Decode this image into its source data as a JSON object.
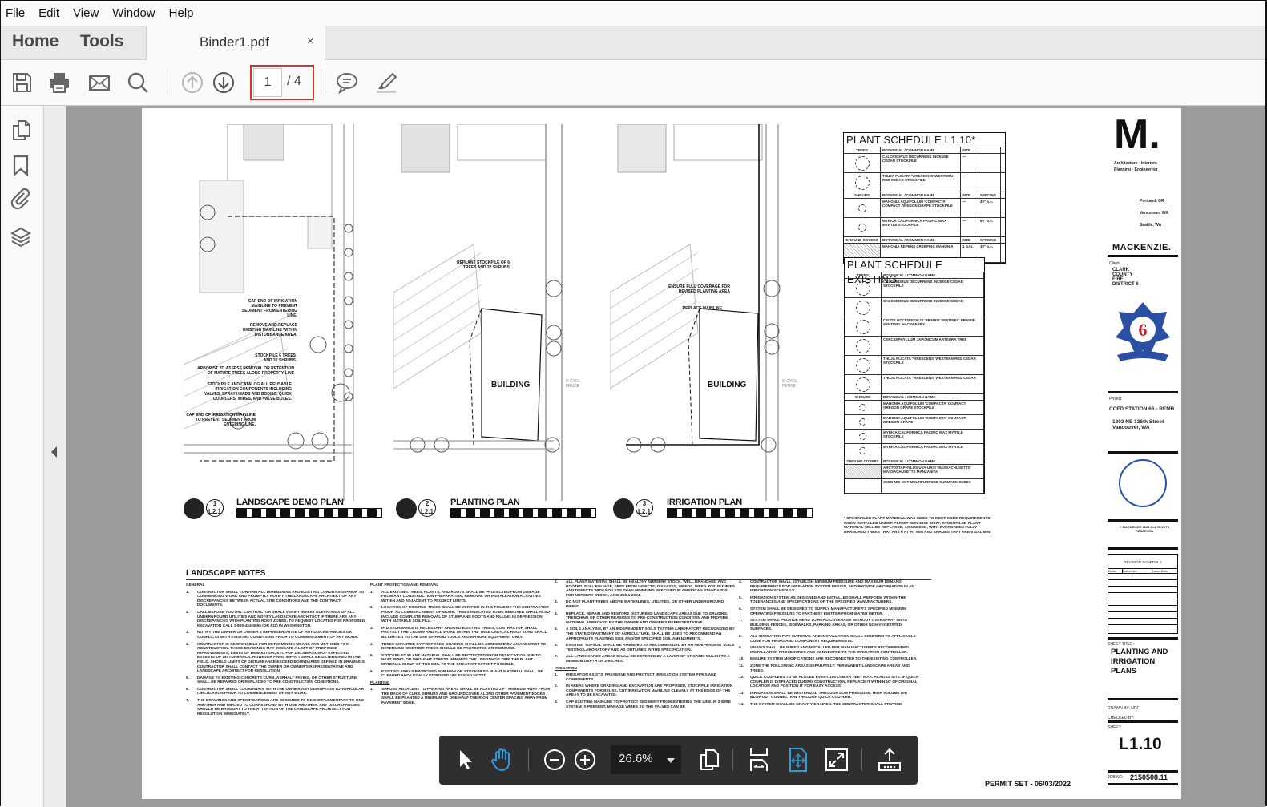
{
  "menu": [
    "File",
    "Edit",
    "View",
    "Window",
    "Help"
  ],
  "tabs": {
    "home": "Home",
    "tools": "Tools",
    "document": "Binder1.pdf",
    "close": "×"
  },
  "toolbar": {
    "current_page": "1",
    "total_pages": "/ 4"
  },
  "float_toolbar": {
    "zoom": "26.6%"
  },
  "colors": {
    "accent": "#2d9ad9",
    "highlight": "#d9342c",
    "viewer_bg": "#9b9b9b",
    "float_bg": "#2f2f2f"
  },
  "plans": [
    {
      "number": "1",
      "sheet": "L2.1",
      "title": "LANDSCAPE DEMO PLAN",
      "notes": [
        "CAP END OF IRRIGATION MAINLINE TO PREVENT SEDIMENT FROM ENTERING LINE.",
        "REMOVE AND REPLACE EXISTING MAINLINE WITHIN DISTURBANCE AREA.",
        "STOCKPILE 6 TREES AND 32 SHRUBS",
        "ARBORIST TO ASSESS REMOVAL OR RETENTION OF MATURE TREES ALONG PROPERTY LINE",
        "STOCKPILE AND CATALOG ALL REUSABLE IRRIGATION COMPONENTS INCLUDING VALVES, SPRAY HEADS AND BODIES, QUICK COUPLERS, WIRES, AND VALVE BOXES.",
        "CAP END OF IRRIGATION MAINLINE TO PREVENT SEDIMENT FROM ENTERING LINE."
      ]
    },
    {
      "number": "2",
      "sheet": "L2.1",
      "title": "PLANTING PLAN",
      "building": "BUILDING",
      "fence": "6' CYCL FENCE",
      "notes": [
        "REPLANT STOCKPILE OF 6 TREES AND 32 SHRUBS"
      ]
    },
    {
      "number": "3",
      "sheet": "L2.1",
      "title": "IRRIGATION PLAN",
      "building": "BUILDING",
      "fence": "6' CYCL FENCE",
      "notes": [
        "ENSURE FULL COVERAGE FOR REVISED PLANTING AREA",
        "REPLACE MAINLINE"
      ]
    }
  ],
  "schedule_l110": {
    "title": "PLANT SCHEDULE L1.10*",
    "sections": [
      {
        "header": [
          "TREES",
          "BOTANICAL / COMMON NAME",
          "SIZE",
          ""
        ],
        "rows": [
          [
            "CALOCEDRUS DECURRENS INCENSE CEDAR STOCKPILE",
            "—",
            ""
          ],
          [
            "THUJA PLICATA 'VIRESCENS' WESTERN RED CEDAR STOCKPILE",
            "—",
            ""
          ]
        ]
      },
      {
        "header": [
          "SHRUBS",
          "BOTANICAL / COMMON NAME",
          "SIZE",
          "SPACING"
        ],
        "rows": [
          [
            "MAHONIA AQUIFOLIUM 'COMPACTA' COMPACT OREGON GRAPE STOCKPILE",
            "—",
            "40\" o.c."
          ],
          [
            "MYRICA CALIFORNICA PACIFIC WAX MYRTLE STOCKPILE",
            "—",
            "60\" o.c."
          ]
        ]
      },
      {
        "header": [
          "GROUND COVERS",
          "BOTANICAL / COMMON NAME",
          "SIZE",
          "SPACING"
        ],
        "rows": [
          [
            "MAHONIA REPENS CREEPING MAHONIA",
            "1 GAL",
            "30\" o.c."
          ]
        ]
      }
    ]
  },
  "schedule_existing": {
    "title": "PLANT SCHEDULE EXISTING",
    "sections": [
      {
        "header": [
          "TREES",
          "BOTANICAL / COMMON NAME"
        ],
        "rows": [
          "CALOCEDRUS DECURRENS INCENSE CEDAR STOCKPILE",
          "CALOCEDRUS DECURRENS INCENSE CEDAR",
          "CELTIS OCCIDENTALIS 'PRAIRIE SENTINEL' PRAIRIE SENTINEL HACKBERRY",
          "CERCIDIPHYLLUM JAPONICUM KATSURA TREE",
          "THUJA PLICATA 'VIRESCENS' WESTERN RED CEDAR STOCKPILE",
          "THUJA PLICATA 'VIRESCENS' WESTERN RED CEDAR"
        ]
      },
      {
        "header": [
          "SHRUBS",
          "BOTANICAL / COMMON NAME"
        ],
        "rows": [
          "MAHONIA AQUIFOLIUM 'COMPACTA' COMPACT OREGON GRAPE STOCKPILE",
          "MAHONIA AQUIFOLIUM 'COMPACTA' COMPACT OREGON GRAPE",
          "MYRICA CALIFORNICA PACIFIC WAX MYRTLE STOCKPILE",
          "MYRICA CALIFORNICA PACIFIC WAX MYRTLE"
        ]
      },
      {
        "header": [
          "GROUND COVERS",
          "BOTANICAL / COMMON NAME"
        ],
        "rows": [
          "ARCTOSTAPHYLOS UVA-URSI 'MASSACHUSETTS' MASSACHUSETTS MANZANITA",
          "SEED MIX DOT MULTIPURPOSE SUNMARK SEEDS"
        ]
      }
    ],
    "footnote": "* STOCKPILED PLANT MATERIAL WAS SIZED TO MEET CODE REQUIREMENTS WHEN INSTALLED UNDER PERMIT CMN-2019-00277. STOCKPILED PLANT MATERIAL WILL BE REPLACED, AS NEEDED, WITH EVERGREEN FULLY BRANCHED TREES THAT ARE 6 FT HT MIN AND SHRUBS THAT ARE 5 GAL MIN."
  },
  "landscape_notes": {
    "title": "LANDSCAPE NOTES",
    "general": {
      "heading": "GENERAL",
      "items": [
        "CONTRACTOR SHALL CONFIRM ALL DIMENSIONS AND EXISTING CONDITIONS PRIOR TO COMMENCING WORK AND PROMPTLY NOTIFY THE LANDSCAPE ARCHITECT OF ANY DISCREPANCIES BETWEEN ACTUAL SITE CONDITIONS AND THE CONTRACT DOCUMENTS.",
        "CALL BEFORE YOU DIG. CONTRACTOR SHALL VERIFY INVERT ELEVATIONS OF ALL UNDERGROUND UTILITIES AND NOTIFY LANDSCAPE ARCHITECT IF THERE ARE ANY DISCREPANCIES WITH PLANTING ROOT ZONES. TO REQUEST LOCATES FOR PROPOSED EXCAVATION CALL 1-800-424-5555 (OR 811) IN WASHINGTON.",
        "NOTIFY THE OWNER OR OWNER'S REPRESENTATIVE OF ANY DISCREPANCIES OR CONFLICTS WITH EXISTING CONDITIONS PRIOR TO COMMENCEMENT OF ANY WORK.",
        "CONTRACTOR IS RESPONSIBLE FOR DETERMINING MEANS AND METHODS FOR CONSTRUCTION. THESE DRAWINGS MAY INDICATE A LIMIT OF PROPOSED IMPROVEMENTS, LIMITS OF DEMOLITION, ETC FOR DELINEATION OF EXPECTED EXTENTS OF DISTURBANCE. HOWEVER FINAL IMPACT SHALL BE DETERMINED IN THE FIELD. SHOULD LIMITS OF DISTURBANCE EXCEED BOUNDARIES DEFINED IN DRAWINGS, CONTRACTOR SHALL CONTACT THE OWNER OR OWNER'S REPRESENTATIVE AND LANDSCAPE ARCHITECT FOR RESOLUTION.",
        "DAMAGE TO EXISTING CONCRETE CURB, ASPHALT PAVING, OR OTHER STRUCTURE SHALL BE REPAIRED OR REPLACED TO PRE CONSTRUCTION CONDITIONS.",
        "CONTRACTOR SHALL COORDINATE WITH THE OWNER ANY DISRUPTION TO VEHICULAR CIRCULATION PRIOR TO COMMENCEMENT OF ANY WORK.",
        "THE DRAWINGS AND SPECIFICATIONS ARE DESIGNED TO BE COMPLEMENTARY TO ONE ANOTHER AND IMPLIED TO CORRESPOND WITH ONE ANOTHER. ANY DISCREPANCIES SHOULD BE BROUGHT TO THE ATTENTION OF THE LANDSCAPE ARCHITECT FOR RESOLUTION IMMEDIATELY."
      ]
    },
    "protection": {
      "heading": "PLANT PROTECTION AND REMOVAL",
      "items": [
        "ALL EXISTING TREES, PLANTS, AND ROOTS SHALL BE PROTECTED FROM DAMAGE FROM ANY CONSTRUCTION PREPARATION, REMOVAL OR INSTALLATION ACTIVITIES WITHIN AND ADJACENT TO PROJECT LIMITS.",
        "LOCATION OF EXISTING TREES SHALL BE VERIFIED IN THE FIELD BY THE CONTRACTOR PRIOR TO COMMENCEMENT OF WORK. TREES INDICATED TO BE REMOVED SHALL ALSO INCLUDE COMPLETE REMOVAL OF STUMP AND ROOTS AND FILLING IN DEPRESSION WITH SUITABLE SOIL FILL.",
        "IF DISTURBANCE IS NECESSARY AROUND EXISTING TREES, CONTRACTOR SHALL PROTECT THE CROWN AND ALL WORK WITHIN THE TREE CRITICAL ROOT ZONE SHALL BE LIMITED TO THE USE OF HAND TOOLS AND MANUAL EQUIPMENT ONLY.",
        "TREES IMPACTED BY PROPOSED GRADING SHALL BE ASSESSED BY AN ARBORIST TO DETERMINE WHETHER TREES SHOULD BE PROTECTED OR REMOVED.",
        "STOCKPILED PLANT MATERIAL SHALL BE PROTECTED FROM DESICCATION DUE TO HEAT, WIND, OR DROUGHT STRESS. MINIMIZE THE LENGTH OF TIME THE PLANT MATERIAL IS OUT OF THE SOIL TO THE GREATEST EXTENT POSSIBLE.",
        "EXISTING AREAS PROPOSED FOR NEW OR STOCKPILED PLANT MATERIAL SHALL BE CLEARED AND LEGALLY DISPOSED UNLESS SO NOTED."
      ]
    },
    "planting": {
      "heading": "PLANTING",
      "items": [
        "SHRUBS ADJACENT TO PARKING AREAS SHALL BE PLANTED 2 FT MINIMUM AWAY FROM THE BACK OF CURB. SHRUBS AND GROUNDCOVER ALONG OTHER PAVEMENT EDGES SHALL BE PLANTED A MINIMUM OF ONE HALF THEIR ON CENTER SPACING AWAY FROM PAVEMENT EDGE.",
        "ALL PLANT MATERIAL SHALL BE HEALTHY NURSERY STOCK, WELL BRANCHED AND ROOTED, FULL FOLIAGE, FREE FROM INSECTS, DISEASES, WEEDS, WEED ROT, INJURIES AND DEFECTS WITH NO LESS THAN MINIMUMS SPECIFIED IN AMERICAN STANDARDS FOR NURSERY STOCK, ANSI Z60.1-2004.",
        "DO NOT PLANT TREES ABOVE WATERLINES, UTILITIES, OR OTHER UNDERGROUND PIPING.",
        "REPLACE, REPAIR AND RESTORE DISTURBED LANDSCAPE AREAS DUE TO GRADING, TRENCHING OR OTHER REASONS TO PRE-CONSTRUCTION CONDITION AND PROVIDE MATERIAL APPROVED BY THE OWNER AND OWNER'S REPRESENTATIVE.",
        "A SOILS ANALYSIS, BY AN INDEPENDENT SOILS TESTING LABORATORY RECOGNIZED BY THE STATE DEPARTMENT OF AGRICULTURE, SHALL BE USED TO RECOMMEND AN APPROPRIATE PLANTING SOIL AND/OR SPECIFIED SOIL AMENDMENTS.",
        "EXISTING TOPSOIL SHALL BE AMENDED AS RECOMMENDED BY AN INDEPENDENT SOILS TESTING LABORATORY AND AS OUTLINED IN THE SPECIFICATION.",
        "ALL LANDSCAPED AREAS SHALL BE COVERED BY A LAYER OF ORGANIC MULCH TO A MINIMUM DEPTH OF 2-INCHES."
      ]
    },
    "irrigation": {
      "heading": "IRRIGATION",
      "items": [
        "IRRIGATION EXISTS. PRESERVE AND PROTECT IRRIGATION SYSTEM PIPES AND COMPONENTS.",
        "IN AREAS WHERE GRADING AND EXCAVATION ARE PROPOSED, STOCKPILE IRRIGATION COMPONENTS FOR REUSE. CUT IRRIGATION MAINLINE CLEANLY AT THE EDGE OF THE AREAS TO BE EXCAVATED.",
        "CAP EXISTING MAINLINE TO PROTECT SEDIMENT FROM ENTERING THE LINE. IF 2 WIRE SYSTEM IS PRESENT, MANAGE WIRES SO THE VALVES CAN BE",
        "CONTRACTOR SHALL ESTABLISH MINIMUM PRESSURE AND MAXIMUM DEMAND REQUIREMENTS FOR IRRIGATION SYSTEM DESIGN, AND PROVIDE INFORMATION IN AN IRRIGATION SCHEDULE.",
        "IRRIGATION SYSTEM AS DESIGNED AND INSTALLED SHALL PERFORM WITHIN THE TOLERANCES AND SPECIFICATIONS OF THE SPECIFIED MANUFACTURERS.",
        "SYSTEM SHALL BE DESIGNED TO SUPPLY MANUFACTURER'S SPECIFIED MINIMUM OPERATING PRESSURE TO FARTHEST EMITTER FROM WATER METER.",
        "SYSTEM SHALL PROVIDE HEAD TO HEAD COVERAGE WITHOUT OVERSPRAY ONTO BUILDING, FENCES, SIDEWALKS, PARKING AREAS, OR OTHER NON-VEGETATED SURFACES.",
        "ALL IRRIGATION PIPE MATERIAL AND INSTALLATION SHALL CONFORM TO APPLICABLE CODE FOR PIPING AND COMPONENT REQUIREMENTS.",
        "VALVES SHALL BE WIRED AND INSTALLED PER MANUFACTURER'S RECOMMENDED INSTALLATION PROCEDURES AND CONNECTED TO THE IRRIGATION CONTROLLER.",
        "ENSURE SYSTEM MODIFICATIONS ARE RECONNECTED TO THE EXISTING CONTROLLER.",
        "ZONE THE FOLLOWING AREAS SEPARATELY: PERMANENT LANDSCAPE AREAS AND TREES.",
        "QUICK COUPLERS TO BE PLACED EVERY 150 LINEAR FEET MAX. ACROSS SITE. IF QUICK COUPLER IS DISPLACED DURING CONSTRUCTION, REPLACE IT WITHIN 10' OF ORIGINAL LOCATION AND POSITION IT FOR EASY ACCESS.",
        "IRRIGATION SHALL BE WINTERIZED THROUGH LOW PRESSURE, HIGH VOLUME AIR BLOWOUT CONNECTION THROUGH QUICK COUPLER.",
        "THE SYSTEM SHALL BE GRAVITY DRAINED. THE CONTRACTOR SHALL PROVIDE"
      ]
    }
  },
  "title_block": {
    "logo": "M.",
    "tagline1": "Architecture · Interiors",
    "tagline2": "Planning · Engineering",
    "offices": [
      "Portland, OR",
      "Vancouver, WA",
      "Seattle, WA"
    ],
    "firm": "MACKENZIE.",
    "client_label": "Client",
    "client": "CLARK COUNTY FIRE DISTRICT 6",
    "fire_logo": "FIRE DIST. 6 — established 1956",
    "project_label": "Project",
    "project": "CCFD STATION 66 - REMB",
    "address": "1303 NE 136th Street Vancouver, WA",
    "copyright": "© MACKENZIE 2022 ALL RIGHTS RESERVED",
    "revision_title": "REVISION SCHEDULE",
    "revision_cols": [
      "Delta",
      "Issued As",
      "Issue Date"
    ],
    "sheet_title_label": "SHEET TITLE:",
    "sheet_title": "PLANTING AND IRRIGATION PLANS",
    "drawn_by": "DRAWN BY: NRF",
    "checked_by": "CHECKED BY:",
    "sheet_label": "SHEET:",
    "sheet": "L1.10",
    "job_label": "JOB NO.",
    "job": "2150508.11"
  },
  "permit": "PERMIT SET - 06/03/2022"
}
